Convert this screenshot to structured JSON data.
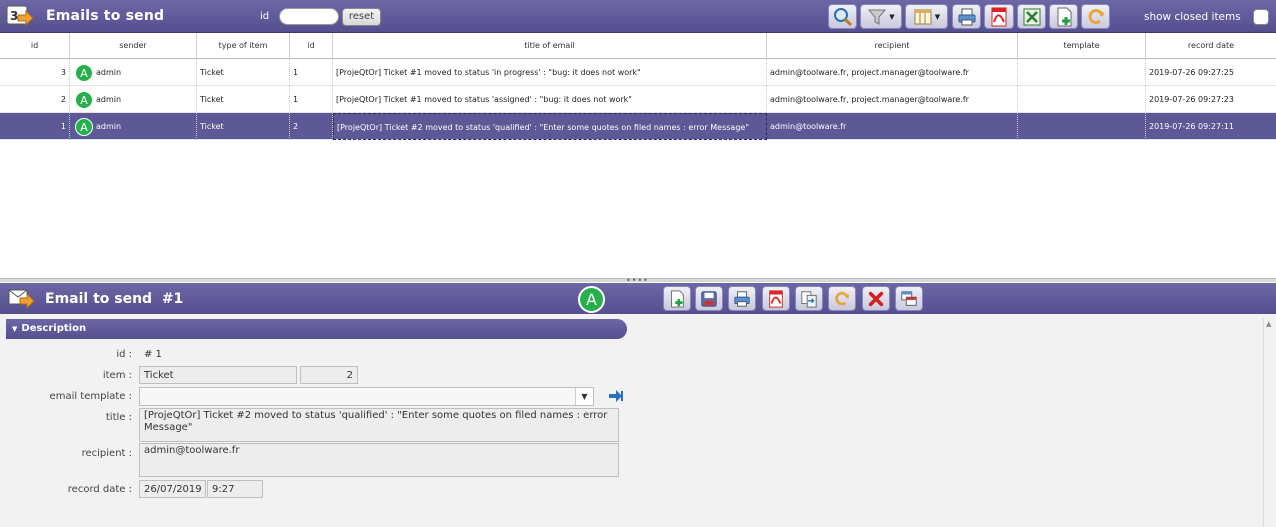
{
  "header": {
    "title": "Emails to send",
    "id_label": "id",
    "id_value": "",
    "reset_label": "reset",
    "show_closed_label": "show closed items",
    "tools": [
      "search-icon",
      "filter-icon",
      "columns-icon",
      "print-icon",
      "pdf-icon",
      "excel-icon",
      "new-icon",
      "refresh-icon"
    ]
  },
  "grid": {
    "columns": [
      "id",
      "sender",
      "type of item",
      "id",
      "title of email",
      "recipient",
      "template",
      "record date"
    ],
    "rows": [
      {
        "id": "3",
        "sender": "admin",
        "type": "Ticket",
        "ref_id": "1",
        "title": "[ProjeQtOr] Ticket #1 moved to status 'in progress' : \"bug: it does not work\"",
        "recipient": "admin@toolware.fr, project.manager@toolware.fr",
        "template": "",
        "date": "2019-07-26 09:27:25",
        "selected": false
      },
      {
        "id": "2",
        "sender": "admin",
        "type": "Ticket",
        "ref_id": "1",
        "title": "[ProjeQtOr] Ticket #1 moved to status 'assigned' : \"bug: it does not work\"",
        "recipient": "admin@toolware.fr, project.manager@toolware.fr",
        "template": "",
        "date": "2019-07-26 09:27:23",
        "selected": false
      },
      {
        "id": "1",
        "sender": "admin",
        "type": "Ticket",
        "ref_id": "2",
        "title": "[ProjeQtOr] Ticket #2 moved to status 'qualified' : \"Enter some quotes on filed names : error Message\"",
        "recipient": "admin@toolware.fr",
        "template": "",
        "date": "2019-07-26 09:27:11",
        "selected": true
      }
    ],
    "avatar_letter": "A"
  },
  "detail": {
    "title": "Email to send",
    "number": "#1",
    "avatar_letter": "A",
    "section": "Description",
    "labels": {
      "id": "id :",
      "item": "item :",
      "template": "email template :",
      "title": "title :",
      "recipient": "recipient :",
      "record_date": "record date :"
    },
    "values": {
      "id": "# 1",
      "item_type": "Ticket",
      "item_id": "2",
      "template": "",
      "title": "[ProjeQtOr] Ticket #2 moved to status 'qualified' : \"Enter some quotes on filed names : error Message\"",
      "recipient": "admin@toolware.fr",
      "record_date": "26/07/2019",
      "record_time": "9:27"
    },
    "tools": [
      "new-icon",
      "save-icon",
      "print-icon",
      "pdf-icon",
      "copy-icon",
      "refresh-icon",
      "delete-icon",
      "multi-update-icon"
    ]
  },
  "colors": {
    "header": "#5d5896",
    "selected_row": "#5d5896",
    "avatar": "#26b04c"
  }
}
